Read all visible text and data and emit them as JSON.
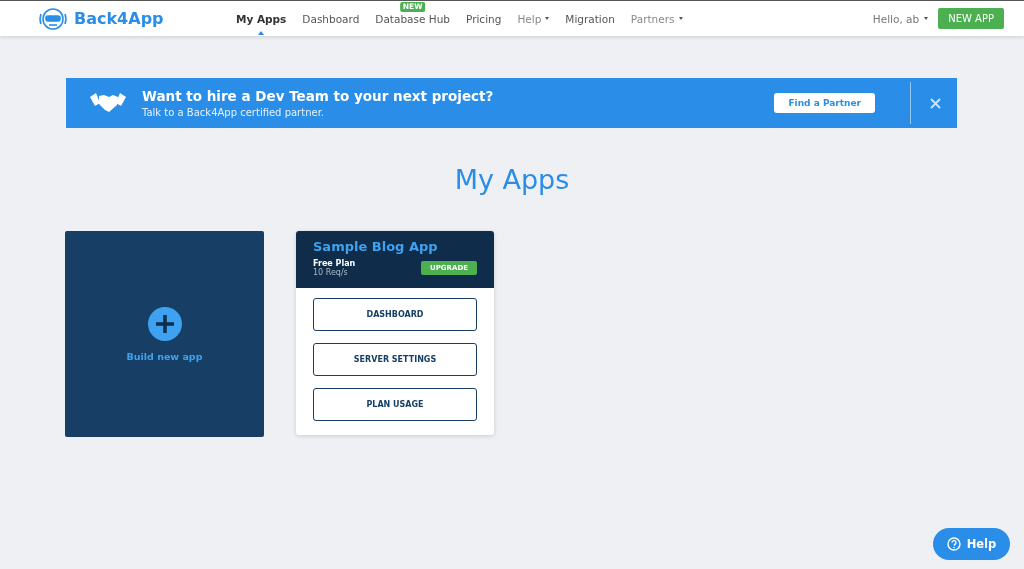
{
  "header": {
    "logo": "Back4App",
    "nav": [
      {
        "label": "My Apps",
        "selected": true,
        "dropdown": false
      },
      {
        "label": "Dashboard",
        "selected": false,
        "dropdown": false
      },
      {
        "label": "Database Hub",
        "selected": false,
        "dropdown": false,
        "badge": "NEW"
      },
      {
        "label": "Pricing",
        "selected": false,
        "dropdown": false
      },
      {
        "label": "Help",
        "selected": false,
        "dropdown": true
      },
      {
        "label": "Migration",
        "selected": false,
        "dropdown": false
      },
      {
        "label": "Partners",
        "selected": false,
        "dropdown": true
      }
    ],
    "user": "Hello, ab",
    "new_app": "NEW APP"
  },
  "banner": {
    "title": "Want to hire a Dev Team to your next project?",
    "subtitle": "Talk to a Back4App certified partner.",
    "button": "Find a Partner"
  },
  "page_title": "My Apps",
  "new_app_card": {
    "label": "Build new app"
  },
  "apps": [
    {
      "name": "Sample Blog App",
      "plan": "Free Plan",
      "requests": "10 Req/s",
      "upgrade": "UPGRADE",
      "actions": [
        "DASHBOARD",
        "SERVER SETTINGS",
        "PLAN USAGE"
      ]
    }
  ],
  "help_button": "Help"
}
